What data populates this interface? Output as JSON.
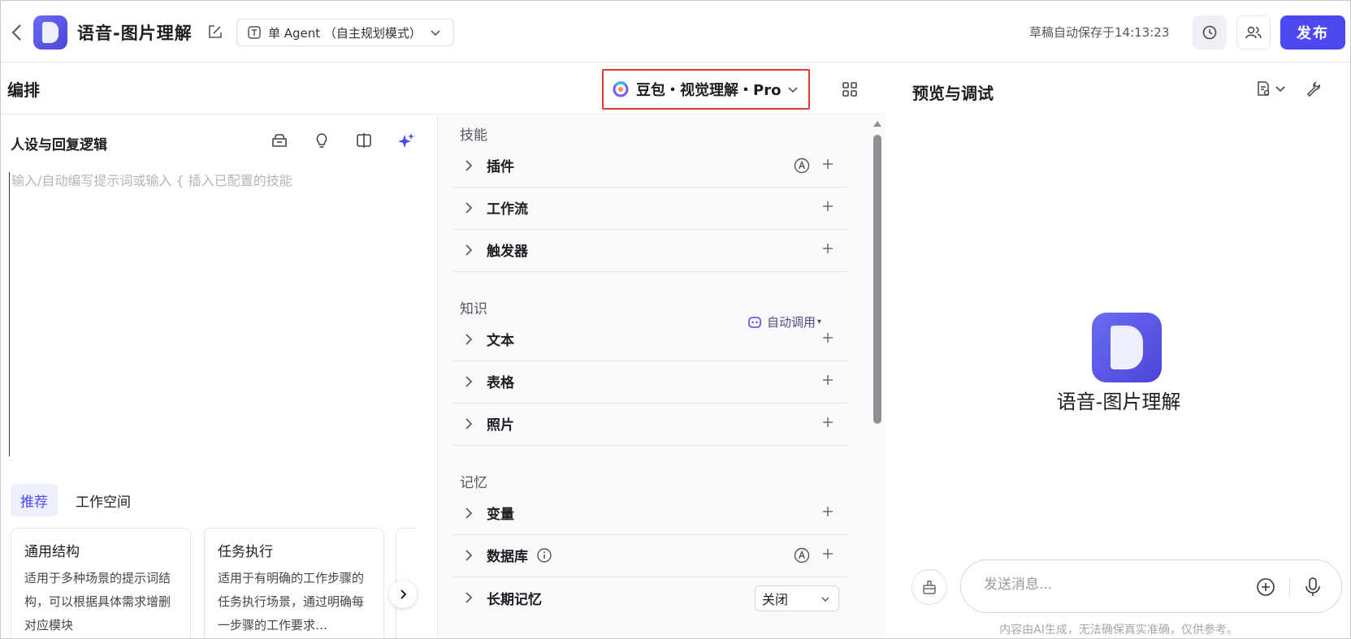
{
  "topbar": {
    "title": "语音-图片理解",
    "mode": "单 Agent （自主规划模式）",
    "autosave": "草稿自动保存于14:13:23",
    "publish": "发布"
  },
  "arrange": {
    "title": "编排",
    "model": "豆包・视觉理解・Pro"
  },
  "persona": {
    "title": "人设与回复逻辑",
    "placeholder": "输入/自动编写提示词或输入 { 插入已配置的技能"
  },
  "templates": {
    "tabs": [
      "推荐",
      "工作空间"
    ],
    "cards": [
      {
        "title": "通用结构",
        "desc": "适用于多种场景的提示词结构，可以根据具体需求增删对应模块"
      },
      {
        "title": "任务执行",
        "desc": "适用于有明确的工作步骤的任务执行场景，通过明确每一步骤的工作要求…"
      }
    ]
  },
  "skills": {
    "section_title": "技能",
    "items": [
      "插件",
      "工作流",
      "触发器"
    ]
  },
  "knowledge": {
    "section_title": "知识",
    "auto_call": "自动调用",
    "items": [
      "文本",
      "表格",
      "照片"
    ]
  },
  "memory": {
    "section_title": "记忆",
    "items": [
      "变量",
      "数据库",
      "长期记忆"
    ],
    "long_term_value": "关闭"
  },
  "preview": {
    "title": "预览与调试",
    "bot_name": "语音-图片理解",
    "message_placeholder": "发送消息...",
    "disclaimer": "内容由AI生成，无法确保真实准确，仅供参考。"
  },
  "colors": {
    "accent": "#4e48f0",
    "highlight_border": "#e03b3b"
  }
}
